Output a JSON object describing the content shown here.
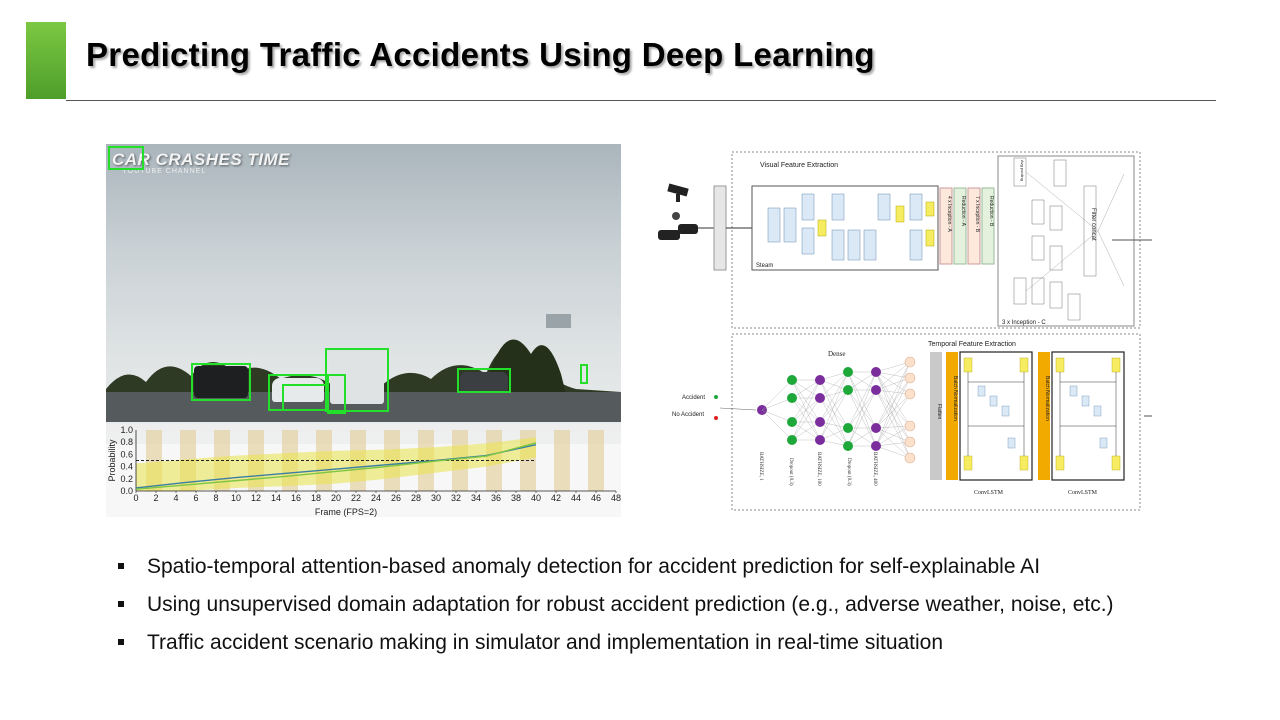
{
  "slide": {
    "title": "Predicting Traffic Accidents Using Deep Learning",
    "accent_color": "#5fad32"
  },
  "left_image": {
    "watermark": "CAR CRASHES TIME",
    "watermark_sub": "YOUTUBE CHANNEL",
    "box_color": "#22e02a"
  },
  "chart_data": {
    "type": "line",
    "xlabel": "Frame (FPS=2)",
    "ylabel": "Probability",
    "xlim": [
      0,
      48
    ],
    "ylim": [
      0,
      1.0
    ],
    "xticks": [
      "0",
      "2",
      "4",
      "6",
      "8",
      "10",
      "12",
      "14",
      "16",
      "18",
      "20",
      "22",
      "24",
      "26",
      "28",
      "30",
      "32",
      "34",
      "36",
      "38",
      "40",
      "42",
      "44",
      "46",
      "48"
    ],
    "yticks": [
      "0.0",
      "0.2",
      "0.4",
      "0.6",
      "0.8",
      "1.0"
    ],
    "threshold": 0.5,
    "x": [
      0,
      5,
      10,
      15,
      20,
      25,
      30,
      35,
      40
    ],
    "series": [
      {
        "values": [
          0.05,
          0.14,
          0.22,
          0.29,
          0.36,
          0.43,
          0.5,
          0.58,
          0.76
        ],
        "color": "#3a7fa0"
      },
      {
        "values": [
          0.03,
          0.1,
          0.17,
          0.24,
          0.32,
          0.4,
          0.49,
          0.57,
          0.79
        ],
        "color": "#7fc642"
      }
    ],
    "band_upper": [
      0.45,
      0.52,
      0.58,
      0.62,
      0.66,
      0.68,
      0.72,
      0.78,
      0.88
    ],
    "band_lower": [
      0.0,
      0.0,
      0.05,
      0.08,
      0.12,
      0.2,
      0.3,
      0.4,
      0.55
    ]
  },
  "diagram": {
    "visual_title": "Visual Feature Extraction",
    "steam_label": "Steam",
    "inception_labels": [
      "4 x Inception - A",
      "Reduction - A",
      "7 x Inception - B",
      "Reduction - B"
    ],
    "inception_c": "3 x Inception - C",
    "filter_concat": "Filter concat",
    "avg_pooling": "Avg pooling",
    "temporal_title": "Temporal Feature Extraction",
    "dense_label": "Dense",
    "accident_label": "Accident",
    "no_accident_label": "No Accident",
    "layer_labels": [
      "BATHSIZE, 1",
      "Dropout (0.3)",
      "BATHSIZE, 100",
      "Dropout (0.3)",
      "BATHSIZE, 400"
    ],
    "flatten": "Flatten",
    "batch_norm": "Batch Normalization",
    "convlstm": "ConvLSTM",
    "colors": {
      "batchnorm": "#f2a900",
      "flatten": "#c9c9c9",
      "green_node": "#1fa83a",
      "purple_node": "#7b2d9e",
      "peach_node": "#fbe0cc"
    }
  },
  "bullets": [
    "Spatio-temporal attention-based anomaly detection for accident prediction for self-explainable AI",
    "Using unsupervised domain adaptation for robust accident prediction (e.g., adverse weather, noise, etc.)",
    "Traffic accident scenario making in simulator and implementation in real-time situation"
  ]
}
